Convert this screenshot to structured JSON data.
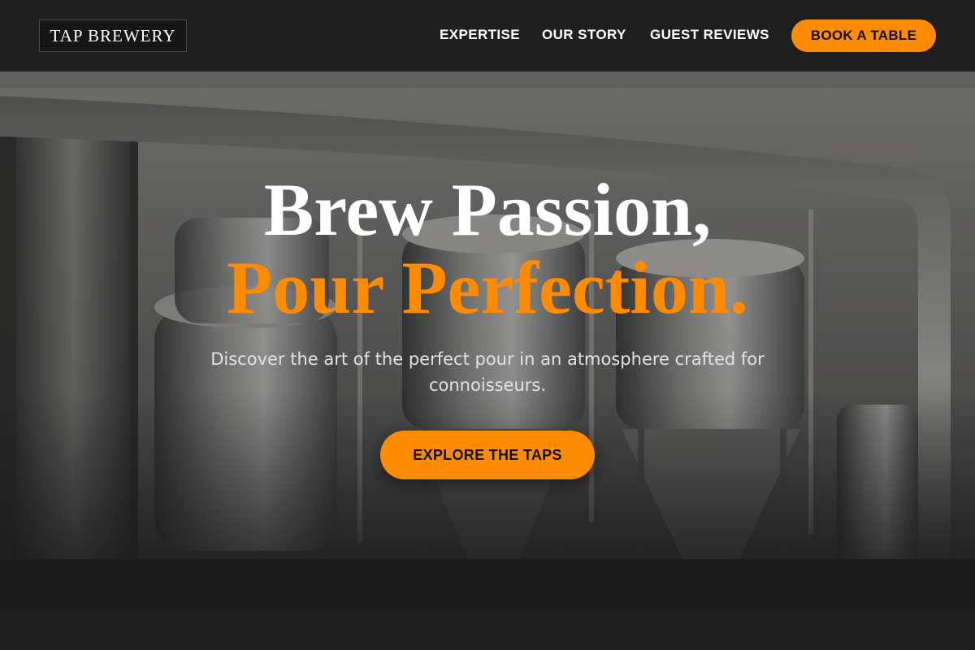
{
  "header": {
    "logo": "TAP BREWERY",
    "nav": {
      "expertise": "EXPERTISE",
      "story": "OUR STORY",
      "reviews": "GUEST REVIEWS"
    },
    "book_label": "BOOK A TABLE"
  },
  "hero": {
    "headline_line1": "Brew Passion,",
    "headline_line2": "Pour Perfection.",
    "subtext": "Discover the art of the perfect pour in an atmosphere crafted for connoisseurs.",
    "cta_label": "EXPLORE THE TAPS",
    "background_image": "brewery-tanks-photo"
  },
  "colors": {
    "accent": "#ff8c00",
    "header_bg": "#1f1f1f",
    "text_light": "#ffffff"
  }
}
